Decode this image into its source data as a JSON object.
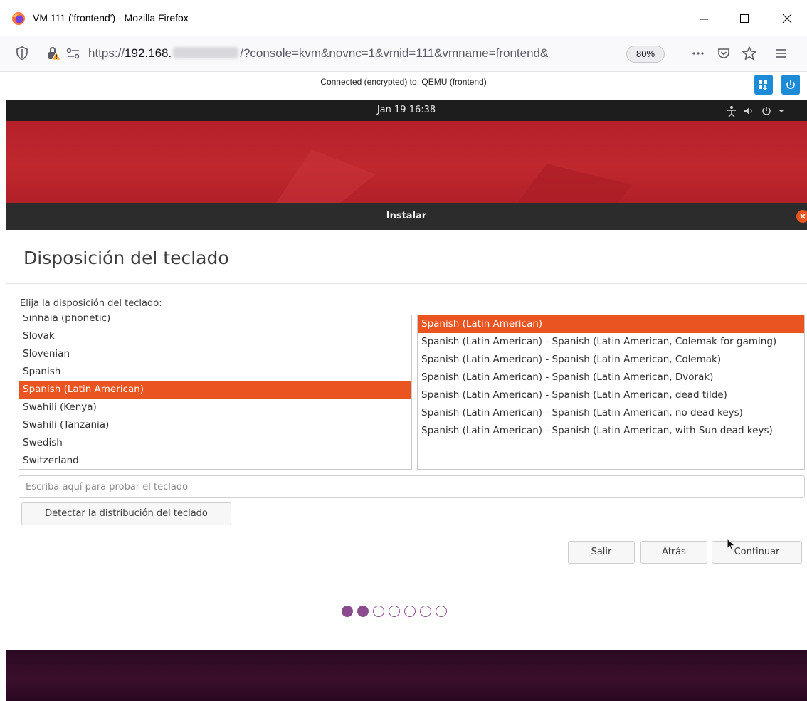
{
  "browser": {
    "window_title": "VM 111 ('frontend') - Mozilla Firefox",
    "url_scheme": "https://",
    "url_host": "192.168.",
    "url_rest": "/?console=kvm&novnc=1&vmid=111&vmname=frontend&",
    "zoom": "80%"
  },
  "vnc": {
    "status": "Connected (encrypted) to: QEMU (frontend)"
  },
  "desktop": {
    "clock": "Jan 19  16:38"
  },
  "installer": {
    "window_title": "Instalar",
    "page_title": "Disposición del teclado",
    "prompt": "Elija la disposición del teclado:",
    "layouts": [
      "Sinhala (phonetic)",
      "Slovak",
      "Slovenian",
      "Spanish",
      "Spanish (Latin American)",
      "Swahili (Kenya)",
      "Swahili (Tanzania)",
      "Swedish",
      "Switzerland"
    ],
    "selected_layout_index": 4,
    "variants": [
      "Spanish (Latin American)",
      "Spanish (Latin American) - Spanish (Latin American, Colemak for gaming)",
      "Spanish (Latin American) - Spanish (Latin American, Colemak)",
      "Spanish (Latin American) - Spanish (Latin American, Dvorak)",
      "Spanish (Latin American) - Spanish (Latin American, dead tilde)",
      "Spanish (Latin American) - Spanish (Latin American, no dead keys)",
      "Spanish (Latin American) - Spanish (Latin American, with Sun dead keys)"
    ],
    "selected_variant_index": 0,
    "test_placeholder": "Escriba aquí para probar el teclado",
    "test_value": "",
    "detect_label": "Detectar la distribución del teclado",
    "quit_label": "Salir",
    "back_label": "Atrás",
    "continue_label": "Continuar",
    "progress": {
      "completed_steps": 2,
      "total_steps": 7
    }
  },
  "colors": {
    "ubuntu_orange": "#e95420",
    "progress_purple": "#8a4c8f",
    "novnc_blue": "#1e8bd6"
  },
  "icons": {
    "browser": "firefox-icon",
    "tracking": "shield-icon",
    "security": "lock-warning-icon",
    "permissions": "permissions-icon",
    "page_actions": "more-icon",
    "pocket": "pocket-icon",
    "bookmark": "star-icon",
    "app_menu": "hamburger-menu-icon"
  }
}
